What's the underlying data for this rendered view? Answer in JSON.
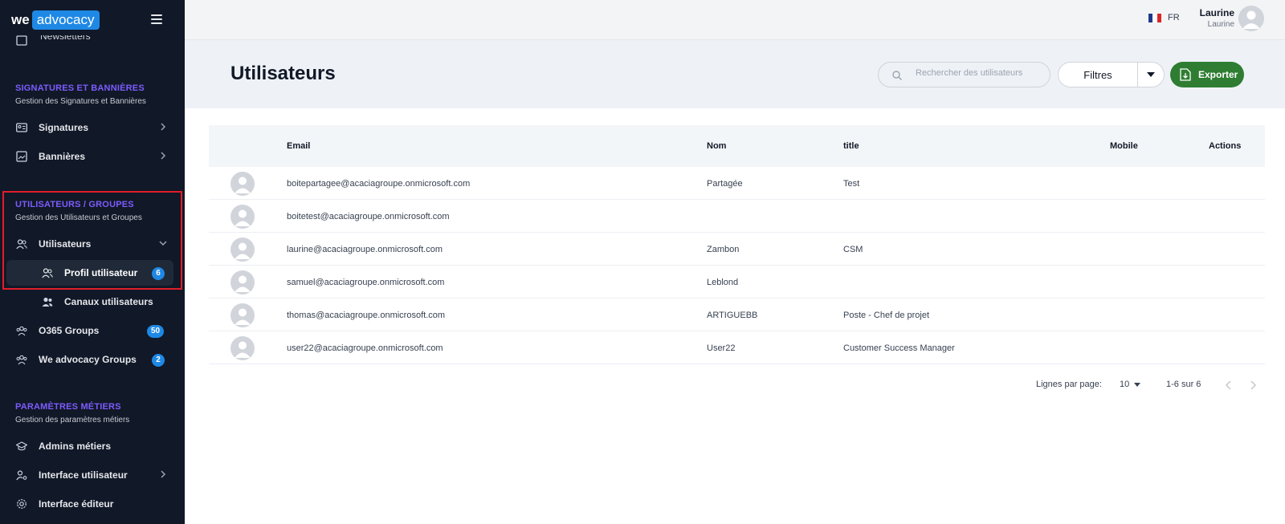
{
  "app": {
    "logo_we": "we",
    "logo_advocacy": "advocacy"
  },
  "sidebar": {
    "partial_item": "Newsletters",
    "sections": [
      {
        "title": "SIGNATURES ET BANNIÈRES",
        "subtitle": "Gestion des Signatures et Bannières"
      },
      {
        "title": "UTILISATEURS / GROUPES",
        "subtitle": "Gestion des Utilisateurs et Groupes"
      },
      {
        "title": "PARAMÈTRES MÉTIERS",
        "subtitle": "Gestion des paramètres métiers"
      }
    ],
    "items": {
      "signatures": "Signatures",
      "bannieres": "Bannières",
      "utilisateurs": "Utilisateurs",
      "profil_utilisateur": "Profil utilisateur",
      "profil_utilisateur_badge": "6",
      "canaux_utilisateurs": "Canaux utilisateurs",
      "o365_groups": "O365 Groups",
      "o365_groups_badge": "50",
      "we_advocacy_groups": "We advocacy Groups",
      "we_advocacy_groups_badge": "2",
      "admins_metiers": "Admins métiers",
      "interface_utilisateur": "Interface utilisateur",
      "interface_editeur": "Interface éditeur"
    }
  },
  "topbar": {
    "language": "FR",
    "user_name": "Laurine",
    "user_sub": "Laurine"
  },
  "page": {
    "title": "Utilisateurs",
    "search_placeholder": "Rechercher des utilisateurs",
    "filter_label": "Filtres",
    "export_label": "Exporter"
  },
  "table": {
    "headers": {
      "email": "Email",
      "nom": "Nom",
      "title": "title",
      "mobile": "Mobile",
      "actions": "Actions"
    },
    "rows": [
      {
        "email": "boitepartagee@acaciagroupe.onmicrosoft.com",
        "nom": "Partagée",
        "title": "Test",
        "mobile": ""
      },
      {
        "email": "boitetest@acaciagroupe.onmicrosoft.com",
        "nom": "",
        "title": "",
        "mobile": ""
      },
      {
        "email": "laurine@acaciagroupe.onmicrosoft.com",
        "nom": "Zambon",
        "title": "CSM",
        "mobile": ""
      },
      {
        "email": "samuel@acaciagroupe.onmicrosoft.com",
        "nom": "Leblond",
        "title": "",
        "mobile": ""
      },
      {
        "email": "thomas@acaciagroupe.onmicrosoft.com",
        "nom": "ARTIGUEBB",
        "title": "Poste - Chef de projet",
        "mobile": ""
      },
      {
        "email": "user22@acaciagroupe.onmicrosoft.com",
        "nom": "User22",
        "title": "Customer Success Manager",
        "mobile": ""
      }
    ]
  },
  "pagination": {
    "rows_label": "Lignes par page:",
    "rows_value": "10",
    "range": "1-6 sur 6"
  },
  "colors": {
    "sidebar_bg": "#111827",
    "section_title": "#7c5cff",
    "badge": "#1e88e5",
    "export": "#2e7d32",
    "highlight": "#e11d2a"
  }
}
